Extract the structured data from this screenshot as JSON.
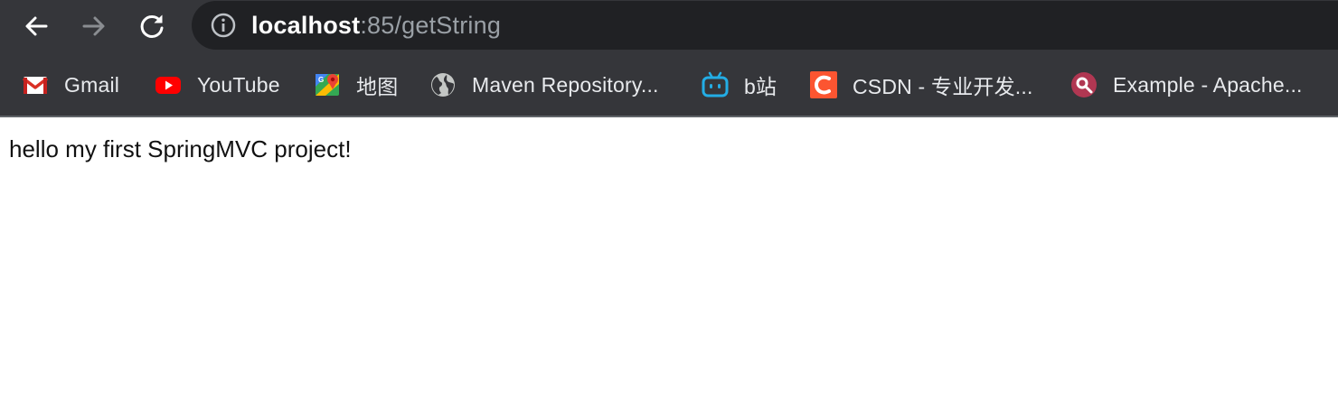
{
  "browser": {
    "url_host": "localhost",
    "url_rest": ":85/getString",
    "icons": {
      "back": "arrow-left-icon",
      "forward": "arrow-right-icon",
      "reload": "reload-icon",
      "site_info": "info-icon"
    }
  },
  "bookmarks": [
    {
      "label": "Gmail",
      "icon": "gmail-icon"
    },
    {
      "label": "YouTube",
      "icon": "youtube-icon"
    },
    {
      "label": "地图",
      "icon": "maps-icon"
    },
    {
      "label": "Maven Repository...",
      "icon": "globe-icon"
    },
    {
      "label": "b站",
      "icon": "bilibili-icon"
    },
    {
      "label": "CSDN - 专业开发...",
      "icon": "csdn-icon"
    },
    {
      "label": "Example - Apache...",
      "icon": "apache-icon"
    }
  ],
  "page": {
    "body_text": "hello my first SpringMVC project!"
  },
  "colors": {
    "chrome_bg": "#35363a",
    "omnibox_bg": "#202124"
  }
}
